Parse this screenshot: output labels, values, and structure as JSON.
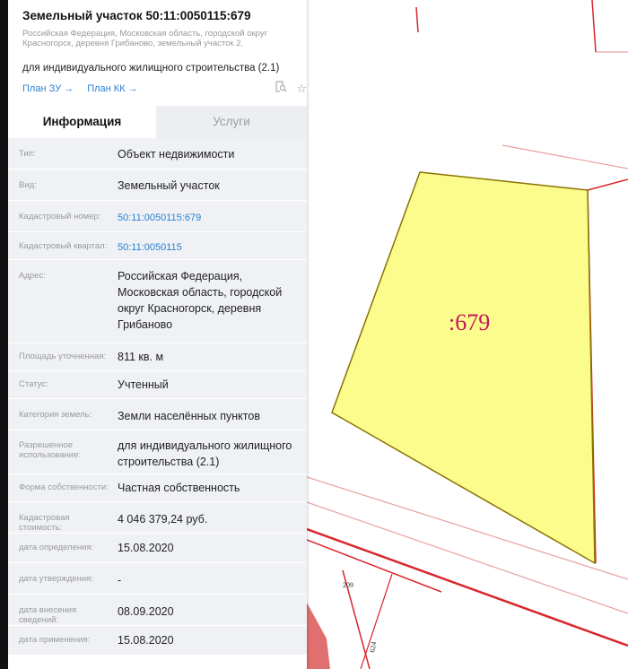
{
  "header": {
    "title": "Земельный участок 50:11:0050115:679",
    "address_small": "Российская Федерация, Московская область, городской округ Красногорск, деревня Грибаново, земельный участок 2.",
    "purpose": "для индивидуального жилищного строительства (2.1)",
    "link_plan_zu": "План ЗУ →",
    "link_plan_kk": "План КК →",
    "icons": [
      "document-search-icon",
      "star-icon"
    ]
  },
  "tabs": [
    {
      "label": "Информация",
      "active": true
    },
    {
      "label": "Услуги",
      "active": false
    }
  ],
  "rows": [
    {
      "label": "Тип:",
      "value": "Объект недвижимости"
    },
    {
      "label": "Вид:",
      "value": "Земельный участок"
    },
    {
      "label": "Кадастровый номер:",
      "value": "50:11:0050115:679",
      "link": true
    },
    {
      "label": "Кадастровый квартал:",
      "value": "50:11:0050115",
      "link": true
    },
    {
      "label": "Адрес:",
      "value": "Российская Федерация, Московская область, городской округ Красногорск, деревня Грибаново"
    },
    {
      "label": "Площадь уточненная:",
      "value": "811 кв. м"
    },
    {
      "label": "Статус:",
      "value": "Учтенный"
    },
    {
      "label": "Категория земель:",
      "value": "Земли населённых пунктов"
    },
    {
      "label": "Разрешенное использование:",
      "value": "для индивидуального жилищного строительства (2.1)"
    },
    {
      "label": "Форма собственности:",
      "value": "Частная собственность"
    },
    {
      "label": "Кадастровая стоимость:",
      "value": "4 046 379,24 руб."
    },
    {
      "label": "дата определения:",
      "value": "15.08.2020"
    },
    {
      "label": "дата утверждения:",
      "value": "-"
    },
    {
      "label": "дата внесения сведений:",
      "value": "08.09.2020"
    },
    {
      "label": "дата применения:",
      "value": "15.08.2020"
    }
  ],
  "map": {
    "parcel_label": ":679",
    "label_209": "209",
    "label_624": "624",
    "parcel_fill": "#fbfc8c",
    "parcel_stroke": "#8a7200",
    "boundary_red": "#d9262b",
    "boundary_pink": "#e8a0a0"
  }
}
